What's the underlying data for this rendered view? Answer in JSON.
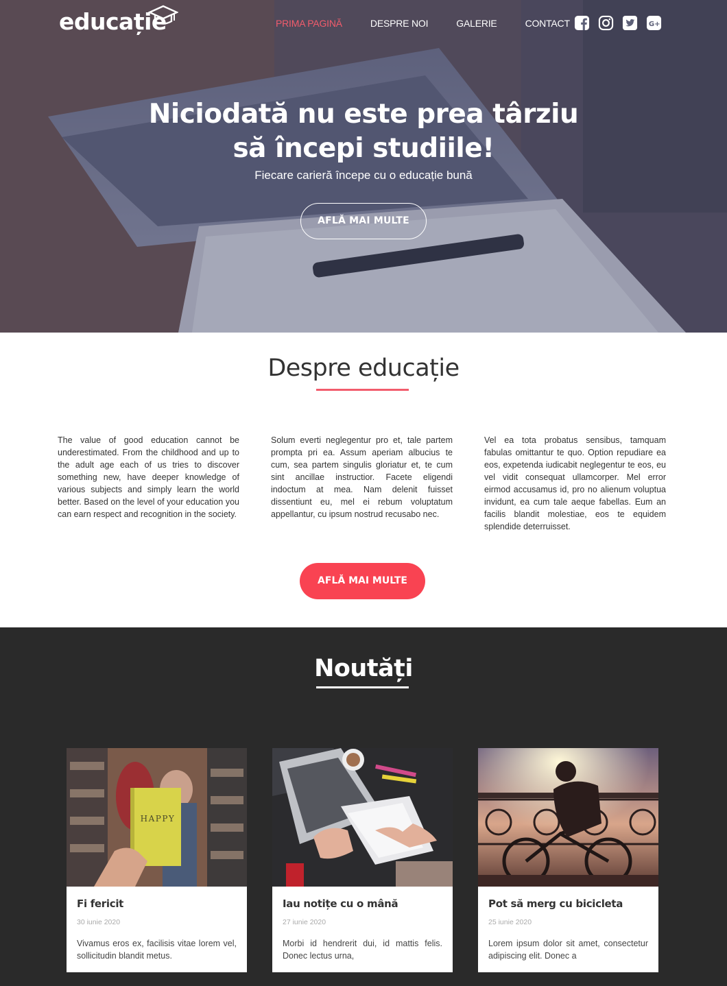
{
  "brand": {
    "logo_text": "educație"
  },
  "nav": {
    "items": [
      {
        "label": "PRIMA PAGINĂ",
        "active": true
      },
      {
        "label": "DESPRE NOI",
        "active": false
      },
      {
        "label": "GALERIE",
        "active": false
      },
      {
        "label": "CONTACT",
        "active": false
      }
    ],
    "socials": [
      "facebook-icon",
      "instagram-icon",
      "twitter-icon",
      "google-plus-icon"
    ]
  },
  "hero": {
    "title": "Niciodată nu este prea târziu să începi studiile!",
    "subtitle": "Fiecare carieră începe cu o educație bună",
    "button": "AFLĂ MAI MULTE"
  },
  "about": {
    "title": "Despre educație",
    "columns": [
      "The value of good education cannot be underestimated. From the childhood and up to the adult age each of us tries to discover something new, have deeper knowledge of various subjects and simply learn the world better. Based on the level of your education you can earn respect and recognition in the society.",
      "Solum everti neglegentur pro et, tale partem prompta pri ea. Assum aperiam albucius te cum, sea partem singulis gloriatur et, te cum sint ancillae instructior. Facete eligendi indoctum at mea. Nam delenit fuisset dissentiunt eu, mel ei rebum voluptatum appellantur, cu ipsum nostrud recusabo nec.",
      "Vel ea tota probatus sensibus, tamquam fabulas omittantur te quo. Option repudiare ea eos, expetenda iudicabit neglegentur te eos, eu vel vidit consequat ullamcorper. Mel error eirmod accusamus id, pro no alienum voluptua invidunt, ea cum tale aeque fabellas. Eum an facilis blandit molestiae, eos te equidem splendide deterruisset."
    ],
    "button": "AFLĂ MAI MULTE"
  },
  "news": {
    "title": "Noutăți",
    "cards": [
      {
        "title": "Fi fericit",
        "date": "30 iunie 2020",
        "text": "Vivamus eros ex, facilisis vitae lorem vel, sollicitudin blandit metus.",
        "book_text": "HAPPY"
      },
      {
        "title": "Iau notițe cu o mână",
        "date": "27 iunie 2020",
        "text": "Morbi id hendrerit dui, id mattis felis. Donec lectus urna,"
      },
      {
        "title": "Pot să merg cu bicicleta",
        "date": "25 iunie 2020",
        "text": "Lorem ipsum dolor sit amet, consectetur adipiscing elit. Donec a"
      }
    ]
  },
  "colors": {
    "accent": "#f94352",
    "dark": "#2a2a2a",
    "nav_active": "#f25c6c"
  }
}
